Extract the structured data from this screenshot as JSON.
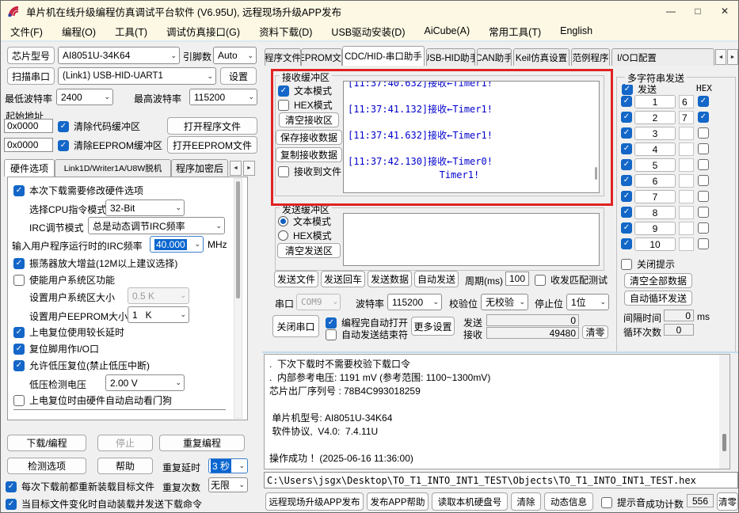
{
  "icons": {
    "chevron_down": "⌄",
    "scroll_left": "◄",
    "scroll_right": "►",
    "minimize": "—",
    "maximize": "□",
    "close": "✕"
  },
  "titlebar": {
    "title": "单片机在线升级编程仿真调试平台软件 (V6.95U), 远程现场升级APP发布"
  },
  "menu": {
    "items": [
      "文件(F)",
      "编程(O)",
      "工具(T)",
      "调试仿真接口(G)",
      "资料下载(D)",
      "USB驱动安装(D)",
      "AiCube(A)",
      "常用工具(T)",
      "English"
    ]
  },
  "left": {
    "chip_label": "芯片型号",
    "chip_value": "AI8051U-34K64",
    "pin_label": "引脚数",
    "pin_value": "Auto",
    "scan_label": "扫描串口",
    "port_value": "(Link1) USB-HID-UART1",
    "settings_label": "设置",
    "min_baud_label": "最低波特率",
    "min_baud": "2400",
    "max_baud_label": "最高波特率",
    "max_baud": "115200",
    "start_addr_label": "起始地址",
    "addr1": "0x0000",
    "clear_code_label": "清除代码缓冲区",
    "open_program_label": "打开程序文件",
    "addr2": "0x0000",
    "clear_eeprom_label": "清除EEPROM缓冲区",
    "open_eeprom_label": "打开EEPROM文件",
    "tabs": [
      "硬件选项",
      "Link1D/Writer1A/U8W脱机",
      "程序加密后"
    ],
    "hw": {
      "modify": "本次下载需要修改硬件选项",
      "cpu_label": "选择CPU指令模式",
      "cpu_value": "32-Bit",
      "irc_label": "IRC调节模式",
      "irc_value": "总是动态调节IRC频率",
      "freq_label": "输入用户程序运行时的IRC频率",
      "freq_value": "40.000",
      "freq_unit": "MHz",
      "osc": "振荡器放大增益(12M以上建议选择)",
      "sysarea": "使能用户系统区功能",
      "sysarea_size_label": "设置用户系统区大小",
      "sysarea_size": "0.5 K",
      "eeprom_size_label": "设置用户EEPROM大小",
      "eeprom_size": "1   K",
      "por_delay": "上电复位使用较长延时",
      "rst_io": "复位脚用作I/O口",
      "lvr": "允许低压复位(禁止低压中断)",
      "lvd_label": "低压检测电压",
      "lvd_value": "2.00 V",
      "wdt": "上电复位时由硬件自动启动看门狗"
    },
    "download_btn": "下载/编程",
    "stop_btn": "停止",
    "repeat_btn": "重复编程",
    "check_btn": "检测选项",
    "help_btn": "帮助",
    "repeat_delay_label": "重复延时",
    "repeat_delay": "3 秒",
    "reload": "每次下载前都重新装载目标文件",
    "repeat_count_label": "重复次数",
    "repeat_count": "无限",
    "autoload": "当目标文件变化时自动装载并发送下载命令"
  },
  "right": {
    "tabs": [
      "程序文件",
      "EEPROM文件",
      "CDC/HID-串口助手",
      "USB-HID助手",
      "CAN助手",
      "Keil仿真设置",
      "范例程序",
      "I/O口配置"
    ],
    "receive": {
      "group": "接收缓冲区",
      "text_mode": "文本模式",
      "hex_mode": "HEX模式",
      "clear": "清空接收区",
      "save": "保存接收数据",
      "copy": "复制接收数据",
      "to_file": "接收到文件",
      "log": "[11:37:40.632]接收←Timer1!\n\n[11:37:41.132]接收←Timer1!\n\n[11:37:41.632]接收←Timer1!\n\n[11:37:42.130]接收←Timer0!\n                Timer1!"
    },
    "send": {
      "group": "发送缓冲区",
      "text_mode": "文本模式",
      "hex_mode": "HEX模式",
      "clear": "清空发送区",
      "content": "",
      "send_file": "发送文件",
      "send_cr": "发送回车",
      "send_data": "发送数据",
      "auto_send": "自动发送",
      "period_label": "周期(ms)",
      "period": "100",
      "match_test": "收发匹配测试"
    },
    "serial": {
      "port_label": "串口",
      "port": "COM9",
      "baud_label": "波特率",
      "baud": "115200",
      "parity_label": "校验位",
      "parity": "无校验",
      "stop_label": "停止位",
      "stop": "1位",
      "close_port": "关闭串口",
      "auto_open": "编程完自动打开",
      "auto_end": "自动发送结束符",
      "more": "更多设置",
      "tx_label": "发送",
      "tx": "0",
      "rx_label": "接收",
      "rx": "49480",
      "clear_count": "清零"
    },
    "multi": {
      "title": "多字符串发送",
      "send_label": "发送",
      "hex_label": "HEX",
      "rows": [
        {
          "t": "1",
          "n": "6"
        },
        {
          "t": "2",
          "n": "7"
        },
        {
          "t": "3",
          "n": ""
        },
        {
          "t": "4",
          "n": ""
        },
        {
          "t": "5",
          "n": ""
        },
        {
          "t": "6",
          "n": ""
        },
        {
          "t": "7",
          "n": ""
        },
        {
          "t": "8",
          "n": ""
        },
        {
          "t": "9",
          "n": ""
        },
        {
          "t": "10",
          "n": ""
        }
      ],
      "close_tip": "关闭提示",
      "clear_all": "清空全部数据",
      "auto_loop": "自动循环发送",
      "interval_label": "间隔时间",
      "interval": "0",
      "interval_unit": "ms",
      "loop_label": "循环次数",
      "loop": "0"
    },
    "info": {
      "log": ".  下次下载时不需要校验下载口令\n.  内部参考电压: 1191 mV (参考范围: 1100~1300mV)\n芯片出厂序列号 : 78B4C993018259\n\n 单片机型号: AI8051U-34K64\n 软件协议,  V4.0:  7.4.11U\n\n操作成功 ！(2025-06-16 11:36:00)"
    },
    "path": "C:\\Users\\jsgx\\Desktop\\TO_T1_INTO_INT1_TEST\\Objects\\TO_T1_INTO_INT1_TEST.hex",
    "bottom": {
      "publish": "远程现场升级APP发布",
      "publish_help": "发布APP帮助",
      "read_disk": "读取本机硬盘号",
      "clear": "清除",
      "dynamic": "动态信息",
      "beep": "提示音",
      "success_label": "成功计数",
      "success_count": "556",
      "reset": "清零"
    }
  }
}
